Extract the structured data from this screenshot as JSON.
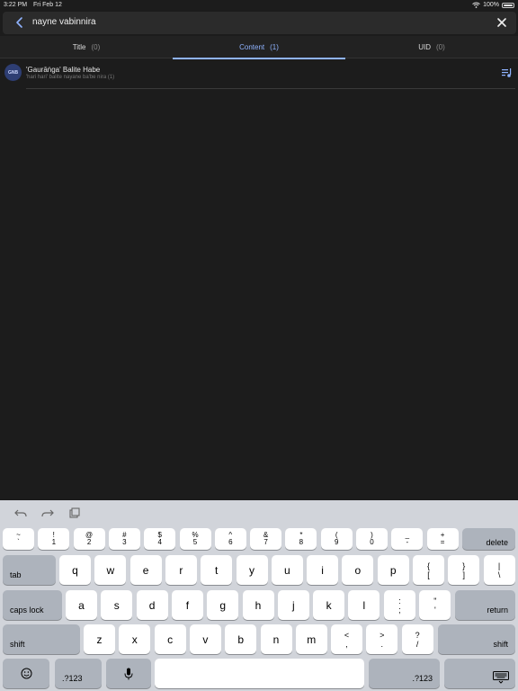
{
  "status_bar": {
    "time": "3:22 PM",
    "date": "Fri Feb 12",
    "battery": "100%"
  },
  "search": {
    "query": "nayne vabinnira",
    "back_icon": "chevron-left-icon",
    "clear_icon": "close-icon"
  },
  "tabs": [
    {
      "label": "Title",
      "count": "(0)"
    },
    {
      "label": "Content",
      "count": "(1)"
    },
    {
      "label": "UID",
      "count": "(0)"
    }
  ],
  "results": [
    {
      "avatar_text": "GNB",
      "title": "'Gaurāṅga' Balite Habe",
      "snippet": "'hari hari' balite nayane ba'be nira (1)"
    }
  ],
  "keyboard": {
    "number_row": [
      [
        "~",
        "`"
      ],
      [
        "!",
        "1"
      ],
      [
        "@",
        "2"
      ],
      [
        "#",
        "3"
      ],
      [
        "$",
        "4"
      ],
      [
        "%",
        "5"
      ],
      [
        "^",
        "6"
      ],
      [
        "&",
        "7"
      ],
      [
        "*",
        "8"
      ],
      [
        "(",
        "9"
      ],
      [
        ")",
        "0"
      ],
      [
        "_",
        "-"
      ],
      [
        "+",
        "="
      ]
    ],
    "delete_label": "delete",
    "tab_label": "tab",
    "row1": [
      "q",
      "w",
      "e",
      "r",
      "t",
      "y",
      "u",
      "i",
      "o",
      "p"
    ],
    "row1_extra": [
      [
        "{",
        "["
      ],
      [
        "}",
        "]"
      ],
      [
        "|",
        "\\"
      ]
    ],
    "caps_label": "caps lock",
    "row2": [
      "a",
      "s",
      "d",
      "f",
      "g",
      "h",
      "j",
      "k",
      "l"
    ],
    "row2_extra": [
      [
        ":",
        ";"
      ],
      [
        "\"",
        "'"
      ]
    ],
    "return_label": "return",
    "shift_label": "shift",
    "row3": [
      "z",
      "x",
      "c",
      "v",
      "b",
      "n",
      "m"
    ],
    "row3_extra": [
      [
        "<",
        ","
      ],
      [
        ">",
        "."
      ],
      [
        "?",
        "/"
      ]
    ],
    "numbers_label": ".?123",
    "space_label": "",
    "accent_color": "#8fb3ff"
  }
}
